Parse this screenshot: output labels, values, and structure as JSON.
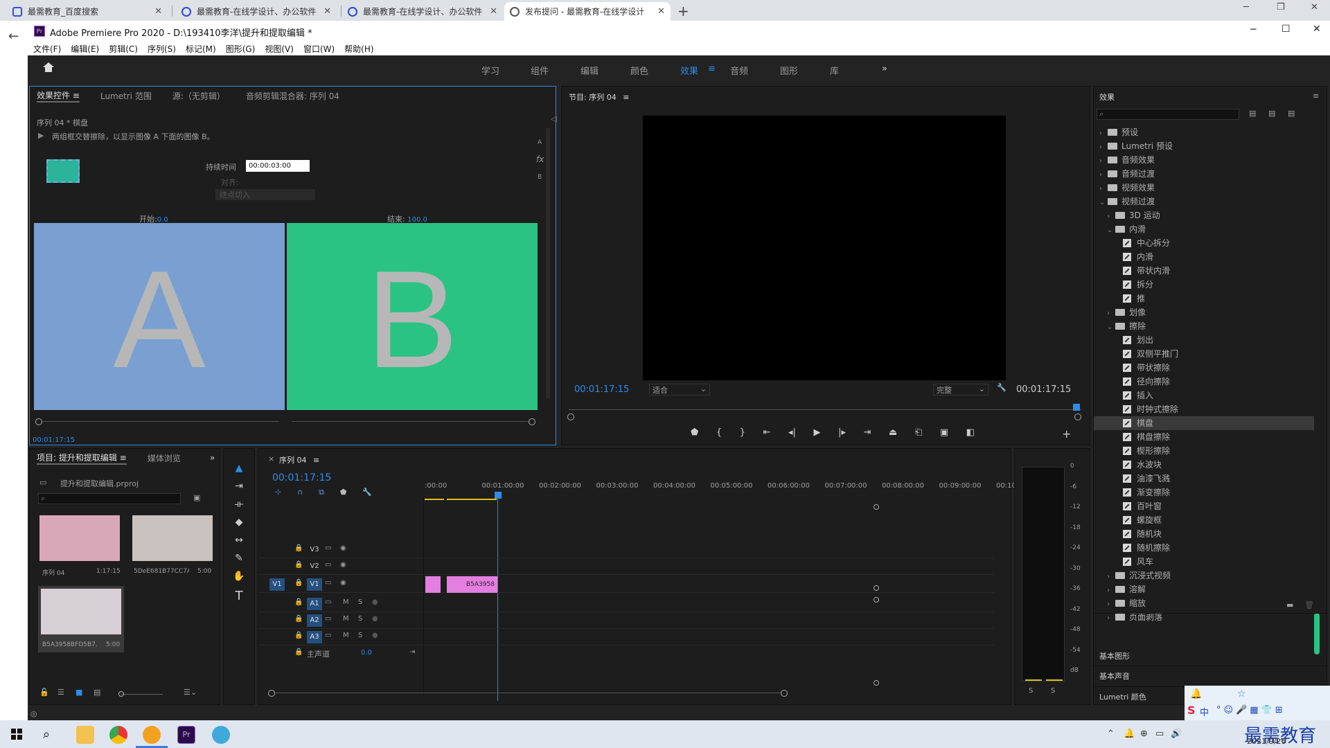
{
  "browser": {
    "tabs": [
      {
        "title": "最需教育_百度搜索",
        "active": false
      },
      {
        "title": "最需教育-在线学设计、办公软件",
        "active": false
      },
      {
        "title": "最需教育-在线学设计、办公软件",
        "active": false
      },
      {
        "title": "发布提问 - 最需教育-在线学设计",
        "active": true
      }
    ],
    "new_tab": "+",
    "back": "←"
  },
  "premiere": {
    "logo": "Pr",
    "title": "Adobe Premiere Pro 2020 - D:\\193410李洋\\提升和提取编辑 *",
    "menu": [
      "文件(F)",
      "编辑(E)",
      "剪辑(C)",
      "序列(S)",
      "标记(M)",
      "图形(G)",
      "视图(V)",
      "窗口(W)",
      "帮助(H)"
    ],
    "workspaces": [
      "学习",
      "组件",
      "编辑",
      "颜色",
      "效果",
      "音频",
      "图形",
      "库"
    ],
    "active_workspace": "效果",
    "more": "»"
  },
  "effect_controls": {
    "tabs": [
      "效果控件",
      "Lumetri 范围",
      "源:（无剪辑）",
      "音频剪辑混合器: 序列 04"
    ],
    "clip_path": "序列 04 * 棋盘",
    "description": "两组框交替擦除，以显示图像 A 下面的图像 B。",
    "duration_label": "持续时间",
    "duration_value": "00:00:03:00",
    "align_label": "对齐:",
    "align_value": "终点切入",
    "start_label": "开始:",
    "start_value": "0.0",
    "end_label": "结束:",
    "end_value": "100.0",
    "a_label": "A",
    "b_label": "B",
    "side_a": "A",
    "side_b": "B",
    "timecode": "00:01:17:15",
    "colors": {
      "a_bg": "#7aa0d2",
      "b_bg": "#2bc384",
      "letter": "#b7b7b7"
    }
  },
  "program": {
    "title": "节目: 序列 04",
    "timecode_left": "00:01:17:15",
    "fit": "适合",
    "quality": "完整",
    "timecode_right": "00:01:17:15"
  },
  "effects_panel": {
    "title": "效果",
    "items": [
      {
        "label": "预设",
        "type": "folder",
        "level": 0,
        "open": false
      },
      {
        "label": "Lumetri 预设",
        "type": "folder",
        "level": 0,
        "open": false
      },
      {
        "label": "音频效果",
        "type": "folder",
        "level": 0,
        "open": false
      },
      {
        "label": "音频过渡",
        "type": "folder",
        "level": 0,
        "open": false
      },
      {
        "label": "视频效果",
        "type": "folder",
        "level": 0,
        "open": false
      },
      {
        "label": "视频过渡",
        "type": "folder",
        "level": 0,
        "open": true
      },
      {
        "label": "3D 运动",
        "type": "folder",
        "level": 1,
        "open": false
      },
      {
        "label": "内滑",
        "type": "folder",
        "level": 1,
        "open": true
      },
      {
        "label": "中心拆分",
        "type": "fx",
        "level": 2
      },
      {
        "label": "内滑",
        "type": "fx",
        "level": 2
      },
      {
        "label": "带状内滑",
        "type": "fx",
        "level": 2
      },
      {
        "label": "拆分",
        "type": "fx",
        "level": 2
      },
      {
        "label": "推",
        "type": "fx",
        "level": 2
      },
      {
        "label": "划像",
        "type": "folder",
        "level": 1,
        "open": false
      },
      {
        "label": "擦除",
        "type": "folder",
        "level": 1,
        "open": true
      },
      {
        "label": "划出",
        "type": "fx",
        "level": 2
      },
      {
        "label": "双侧平推门",
        "type": "fx",
        "level": 2
      },
      {
        "label": "带状擦除",
        "type": "fx",
        "level": 2
      },
      {
        "label": "径向擦除",
        "type": "fx",
        "level": 2
      },
      {
        "label": "插入",
        "type": "fx",
        "level": 2
      },
      {
        "label": "时钟式擦除",
        "type": "fx",
        "level": 2
      },
      {
        "label": "棋盘",
        "type": "fx",
        "level": 2,
        "selected": true
      },
      {
        "label": "棋盘擦除",
        "type": "fx",
        "level": 2
      },
      {
        "label": "楔形擦除",
        "type": "fx",
        "level": 2
      },
      {
        "label": "水波块",
        "type": "fx",
        "level": 2
      },
      {
        "label": "油漆飞溅",
        "type": "fx",
        "level": 2
      },
      {
        "label": "渐变擦除",
        "type": "fx",
        "level": 2
      },
      {
        "label": "百叶窗",
        "type": "fx",
        "level": 2
      },
      {
        "label": "螺旋框",
        "type": "fx",
        "level": 2
      },
      {
        "label": "随机块",
        "type": "fx",
        "level": 2
      },
      {
        "label": "随机擦除",
        "type": "fx",
        "level": 2
      },
      {
        "label": "风车",
        "type": "fx",
        "level": 2
      },
      {
        "label": "沉浸式视频",
        "type": "folder",
        "level": 1,
        "open": false
      },
      {
        "label": "溶解",
        "type": "folder",
        "level": 1,
        "open": false
      },
      {
        "label": "缩放",
        "type": "folder",
        "level": 1,
        "open": false
      },
      {
        "label": "页面剥落",
        "type": "folder",
        "level": 1,
        "open": false
      }
    ],
    "bottom_panels": [
      "基本图形",
      "基本声音",
      "Lumetri 颜色"
    ]
  },
  "project": {
    "tabs": [
      "项目: 提升和提取编辑",
      "媒体浏览"
    ],
    "more": "»",
    "file": "提升和提取编辑.prproj",
    "thumbs": [
      {
        "name": "序列 04",
        "dur": "1:17:15"
      },
      {
        "name": "5DeE681B77CC7A...",
        "dur": "5:00"
      },
      {
        "name": "B5A3958BFD5B7...",
        "dur": "5:00"
      }
    ]
  },
  "timeline": {
    "title": "序列 04",
    "timecode": "00:01:17:15",
    "ruler": [
      ":00:00",
      "00:01:00:00",
      "00:02:00:00",
      "00:03:00:00",
      "00:04:00:00",
      "00:05:00:00",
      "00:06:00:00",
      "00:07:00:00",
      "00:08:00:00",
      "00:09:00:00",
      "00:10"
    ],
    "video_tracks": [
      "V3",
      "V2",
      "V1"
    ],
    "audio_tracks": [
      "A1",
      "A2",
      "A3"
    ],
    "source_v1": "V1",
    "master": "主声道",
    "master_value": "0.0",
    "clip_name": "B5A3958",
    "mute": "M",
    "solo": "S"
  },
  "meter": {
    "scale": [
      "0",
      "-6",
      "-12",
      "-18",
      "-24",
      "-30",
      "-36",
      "-42",
      "-48",
      "-54",
      "dB"
    ],
    "solo": "S"
  },
  "taskbar": {
    "date": "2021/9/26",
    "watermark": "最需教育",
    "ime": "中"
  }
}
